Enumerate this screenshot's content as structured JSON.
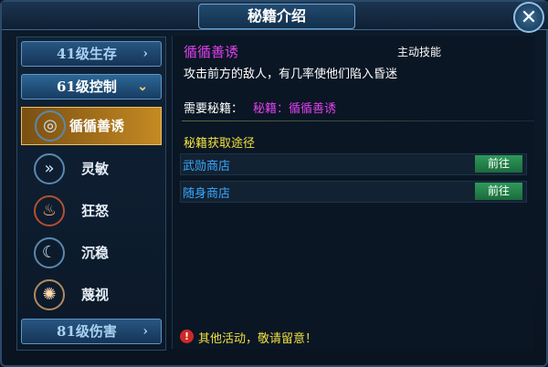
{
  "window": {
    "title": "秘籍介绍",
    "close_glyph": "✕"
  },
  "left_panel": {
    "level_top": {
      "label": "41级生存",
      "chevron": "›"
    },
    "level_open": {
      "label": "61级控制",
      "chevron": "⌄"
    },
    "skills": [
      {
        "name": "循循善诱",
        "icon": "vortex-icon",
        "glyph": "◎"
      },
      {
        "name": "灵敏",
        "icon": "arrows-icon",
        "glyph": "»"
      },
      {
        "name": "狂怒",
        "icon": "rage-icon",
        "glyph": "♨"
      },
      {
        "name": "沉稳",
        "icon": "calm-icon",
        "glyph": "☾"
      },
      {
        "name": "蔑视",
        "icon": "scorn-icon",
        "glyph": "✺"
      }
    ],
    "level_bottom": {
      "label": "81级伤害",
      "chevron": "›"
    }
  },
  "detail": {
    "skill_name": "循循善诱",
    "skill_type": "主动技能",
    "description": "攻击前方的敌人，有几率使他们陷入昏迷",
    "need_label": "需要秘籍：",
    "need_value": "秘籍：循循善诱",
    "source_title": "秘籍获取途径",
    "sources": [
      {
        "name": "武勋商店",
        "go": "前往"
      },
      {
        "name": "随身商店",
        "go": "前往"
      }
    ],
    "notice": "其他活动，敬请留意！",
    "notice_icon": "!"
  },
  "colors": {
    "accent_magenta": "#e040f0",
    "accent_yellow": "#f0e040",
    "link_blue": "#3aa8ff",
    "go_green": "#2f9a5a"
  }
}
